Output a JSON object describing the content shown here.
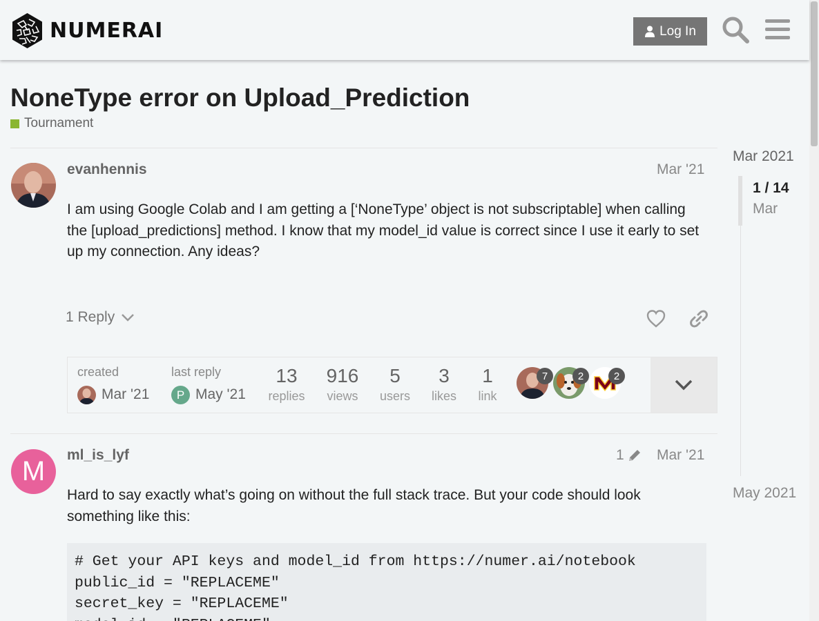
{
  "header": {
    "brand": "NUMERAI",
    "login_label": "Log In"
  },
  "topic": {
    "title": "NoneType error on Upload_Prediction",
    "category": "Tournament",
    "category_color": "#8ab631"
  },
  "posts": [
    {
      "username": "evanhennis",
      "date": "Mar '21",
      "body": "I am using Google Colab and I am getting a [‘NoneType’ object is not subscriptable] when calling the [upload_predictions] method. I know that my model_id value is correct since I use it early to set up my connection. Any ideas?",
      "replies_label": "1 Reply"
    },
    {
      "username": "ml_is_lyf",
      "avatar_letter": "M",
      "avatar_color": "#e8619b",
      "edit_count": "1",
      "date": "Mar '21",
      "body": "Hard to say exactly what’s going on without the full stack trace. But your code should look something like this:",
      "code": "# Get your API keys and model_id from https://numer.ai/notebook\npublic_id = \"REPLACEME\"\nsecret_key = \"REPLACEME\"\nmodel_id = \"REPLACEME\""
    }
  ],
  "topic_map": {
    "created_label": "created",
    "created_date": "Mar '21",
    "last_reply_label": "last reply",
    "last_reply_avatar_letter": "P",
    "last_reply_date": "May '21",
    "stats": [
      {
        "value": "13",
        "label": "replies"
      },
      {
        "value": "916",
        "label": "views"
      },
      {
        "value": "5",
        "label": "users"
      },
      {
        "value": "3",
        "label": "likes"
      },
      {
        "value": "1",
        "label": "link"
      }
    ],
    "participants": [
      {
        "count": "7"
      },
      {
        "count": "2"
      },
      {
        "count": "2"
      }
    ]
  },
  "timeline": {
    "start_label": "Mar 2021",
    "position": "1 / 14",
    "position_date": "Mar",
    "end_label": "May 2021"
  }
}
